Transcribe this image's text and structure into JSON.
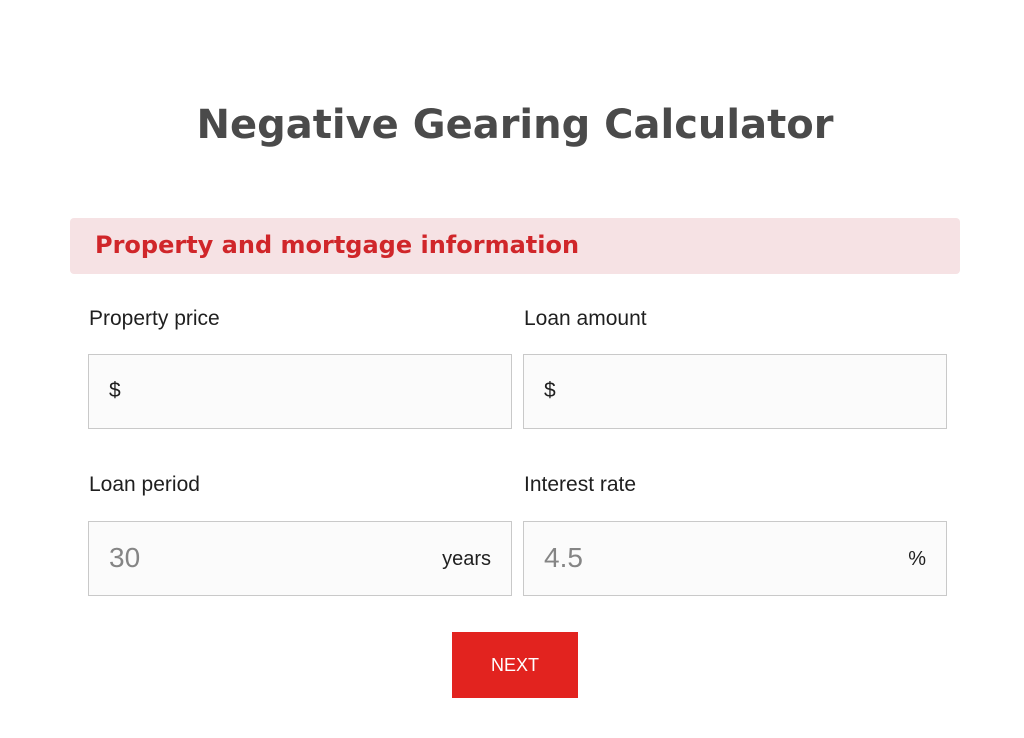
{
  "page": {
    "title": "Negative Gearing Calculator"
  },
  "section": {
    "title": "Property and mortgage information"
  },
  "fields": {
    "property_price": {
      "label": "Property price",
      "prefix": "$",
      "value": ""
    },
    "loan_amount": {
      "label": "Loan amount",
      "prefix": "$",
      "value": ""
    },
    "loan_period": {
      "label": "Loan period",
      "value": "30",
      "suffix": "years"
    },
    "interest_rate": {
      "label": "Interest rate",
      "value": "4.5",
      "suffix": "%"
    }
  },
  "actions": {
    "next_label": "NEXT"
  },
  "colors": {
    "accent": "#e2231f",
    "section_bg": "#f6e2e4",
    "section_text": "#d0262a",
    "title_text": "#4a4a4a"
  }
}
